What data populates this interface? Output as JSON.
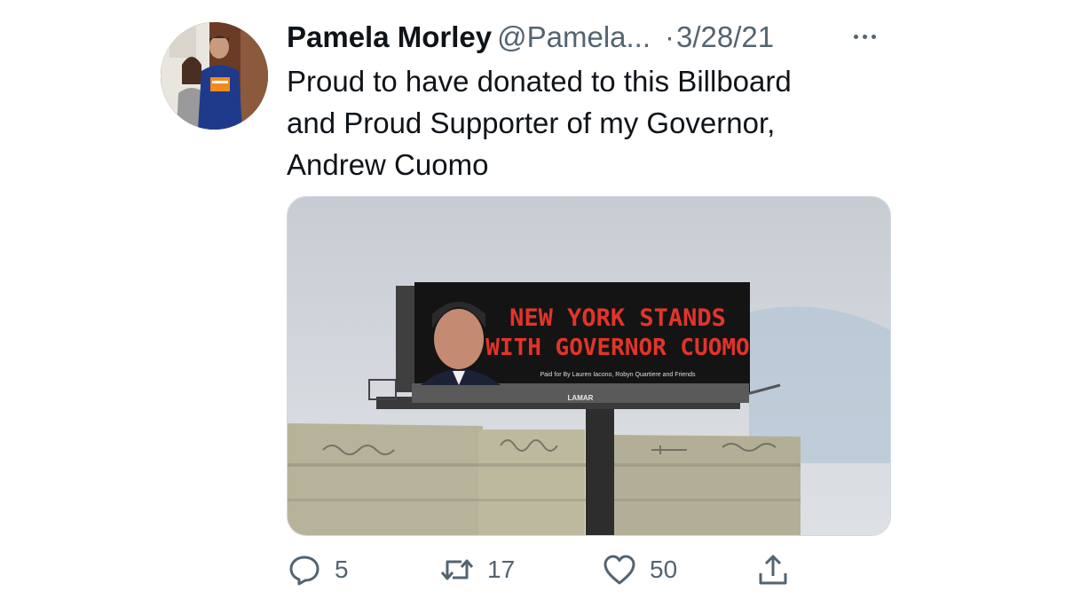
{
  "tweet": {
    "author_name": "Pamela Morley",
    "author_handle": "@Pamela...",
    "separator": "·",
    "date": "3/28/21",
    "text_lines": [
      "Proud to have donated to this Billboard",
      "and Proud Supporter of my Governor,",
      "Andrew Cuomo"
    ]
  },
  "media": {
    "billboard_headline_1": "NEW YORK STANDS",
    "billboard_headline_2": "WITH GOVERNOR CUOMO",
    "billboard_credit": "Paid for By Lauren Iacono, Robyn Quartiere and Friends",
    "billboard_brand": "LAMAR"
  },
  "actions": {
    "reply": {
      "icon": "reply-icon",
      "count": "5"
    },
    "retweet": {
      "icon": "retweet-icon",
      "count": "17"
    },
    "like": {
      "icon": "heart-icon",
      "count": "50"
    },
    "share": {
      "icon": "share-icon"
    }
  },
  "colors": {
    "text_primary": "#0f1419",
    "text_secondary": "#536471",
    "billboard_text": "#e3342a",
    "billboard_bg": "#141414"
  }
}
